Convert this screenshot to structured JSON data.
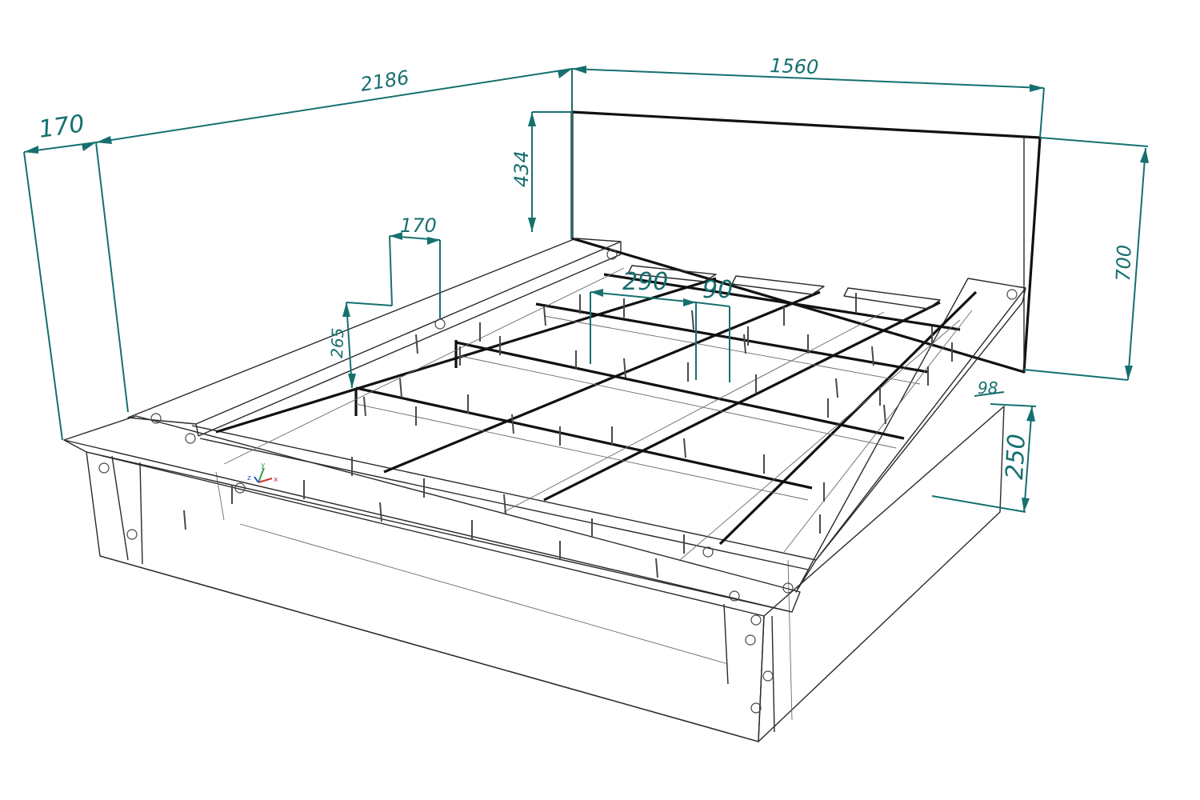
{
  "drawing": {
    "subject": "bed-frame-assembly",
    "colors": {
      "dimension": "#16706f",
      "outline": "#111111",
      "edge": "#2a2a2a"
    }
  },
  "dimensions": {
    "overall_length": "2186",
    "overall_width": "1560",
    "side_rail_depth": "170",
    "rail_width": "170",
    "headboard_top": "434",
    "headboard_height": "700",
    "rail_height": "265",
    "slat_spacing": "290",
    "slat_width": "90",
    "leg_offset": "98",
    "base_height": "250"
  },
  "axis_triad": {
    "x": "x",
    "y": "y",
    "z": "z"
  }
}
